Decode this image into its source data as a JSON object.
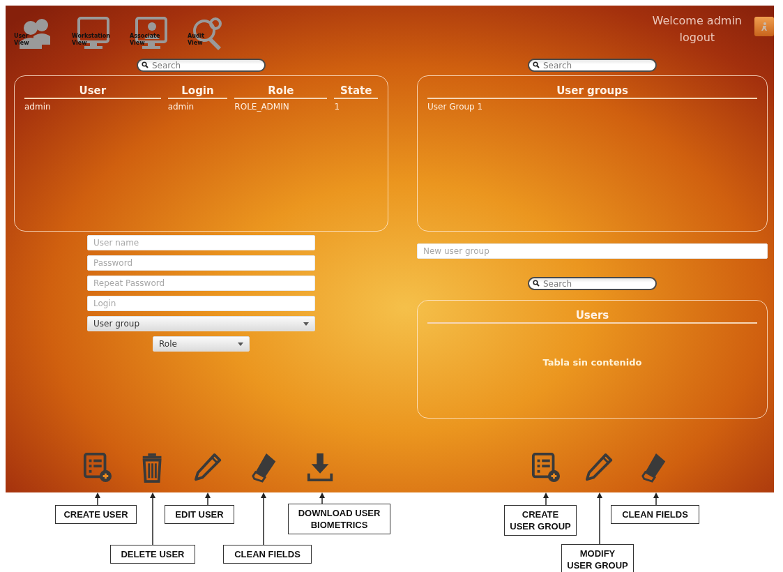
{
  "nav": [
    {
      "label": "User View",
      "kind": "users"
    },
    {
      "label": "Workstation View",
      "kind": "monitor"
    },
    {
      "label": "Associate View",
      "kind": "monitor-users"
    },
    {
      "label": "Audit View",
      "kind": "audit"
    }
  ],
  "header": {
    "welcome": "Welcome admin",
    "logout": "logout"
  },
  "users_panel": {
    "search": {
      "placeholder": "Search"
    },
    "columns": [
      "User",
      "Login",
      "Role",
      "State"
    ],
    "rows": [
      [
        "admin",
        "admin",
        "ROLE_ADMIN",
        "1"
      ]
    ]
  },
  "user_form": {
    "fields": [
      {
        "kind": "text",
        "placeholder": "User name"
      },
      {
        "kind": "text",
        "placeholder": "Password"
      },
      {
        "kind": "text",
        "placeholder": "Repeat Password"
      },
      {
        "kind": "text",
        "placeholder": "Login"
      },
      {
        "kind": "select",
        "value": "User group"
      }
    ],
    "role": {
      "value": "Role"
    }
  },
  "groups_panel": {
    "search": {
      "placeholder": "Search"
    },
    "columns": [
      "User groups"
    ],
    "rows": [
      [
        "User Group 1"
      ]
    ]
  },
  "new_group": {
    "placeholder": "New user group"
  },
  "members_panel": {
    "search": {
      "placeholder": "Search"
    },
    "columns": [
      "Users"
    ],
    "empty_text": "Tabla sin contenido"
  },
  "user_actions": [
    {
      "kind": "create"
    },
    {
      "kind": "delete"
    },
    {
      "kind": "edit"
    },
    {
      "kind": "clean"
    },
    {
      "kind": "download"
    }
  ],
  "group_actions": [
    {
      "kind": "create"
    },
    {
      "kind": "edit"
    },
    {
      "kind": "clean"
    }
  ],
  "annotations": [
    {
      "label": "CREATE USER"
    },
    {
      "label": "DELETE USER"
    },
    {
      "label": "EDIT USER"
    },
    {
      "label": "CLEAN FIELDS"
    },
    {
      "label": "DOWNLOAD USER BIOMETRICS"
    },
    {
      "label": "CREATE USER GROUP"
    },
    {
      "label": "MODIFY USER GROUP"
    },
    {
      "label": "CLEAN FIELDS"
    }
  ]
}
